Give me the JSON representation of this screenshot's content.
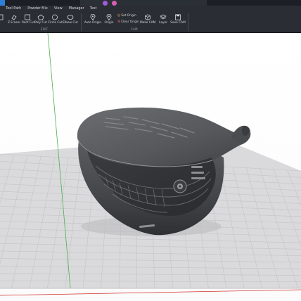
{
  "menu": {
    "items": [
      "Tool Path",
      "Powder Mix",
      "View",
      "Manager",
      "Test"
    ]
  },
  "ribbon": {
    "edit_tools": [
      {
        "label": "Z Eraser",
        "icon": "eraser-icon"
      },
      {
        "label": "Rect Cut",
        "icon": "rect-cut-icon"
      },
      {
        "label": "Poly Cut",
        "icon": "poly-cut-icon"
      },
      {
        "label": "Circle Cut",
        "icon": "circle-cut-icon"
      },
      {
        "label": "Elbow Cut",
        "icon": "elbow-cut-icon"
      }
    ],
    "edit_group_label": "EDIT",
    "cam_tools": [
      {
        "label": "Auto Origin",
        "icon": "pin-icon"
      },
      {
        "label": "Origin",
        "icon": "pin-icon"
      },
      {
        "label": "Make CAM",
        "icon": "cube-icon"
      },
      {
        "label": "Layer",
        "icon": "layers-icon"
      },
      {
        "label": "Save CAM",
        "icon": "save-icon"
      }
    ],
    "set_origin_label": "Set Origin",
    "clear_origin_label": "Clear Origin",
    "cam_group_label": "CAM"
  },
  "colors": {
    "ribbon_bg": "#2a2d33",
    "title_bg": "#1c1f25",
    "accent_blue": "#2f7fd8",
    "axis_green": "#4caf50",
    "axis_red": "#d32f2f",
    "grid_floor": "#d9d9db",
    "model_gray": "#4e5054"
  },
  "viewport": {
    "scene": "3D model of a golf driver head on a grid floor",
    "grid": true,
    "axes": [
      "x-axis-red",
      "y-axis-green"
    ]
  }
}
